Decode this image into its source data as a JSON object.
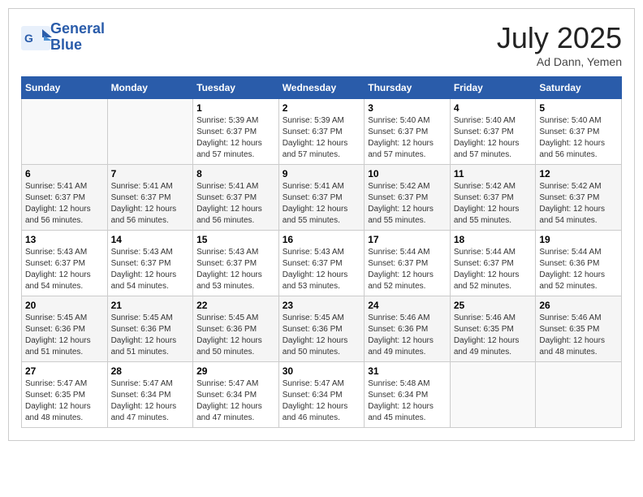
{
  "logo": {
    "line1": "General",
    "line2": "Blue"
  },
  "title": "July 2025",
  "subtitle": "Ad Dann, Yemen",
  "days_header": [
    "Sunday",
    "Monday",
    "Tuesday",
    "Wednesday",
    "Thursday",
    "Friday",
    "Saturday"
  ],
  "weeks": [
    [
      {
        "day": "",
        "info": ""
      },
      {
        "day": "",
        "info": ""
      },
      {
        "day": "1",
        "sunrise": "5:39 AM",
        "sunset": "6:37 PM",
        "daylight": "12 hours and 57 minutes."
      },
      {
        "day": "2",
        "sunrise": "5:39 AM",
        "sunset": "6:37 PM",
        "daylight": "12 hours and 57 minutes."
      },
      {
        "day": "3",
        "sunrise": "5:40 AM",
        "sunset": "6:37 PM",
        "daylight": "12 hours and 57 minutes."
      },
      {
        "day": "4",
        "sunrise": "5:40 AM",
        "sunset": "6:37 PM",
        "daylight": "12 hours and 57 minutes."
      },
      {
        "day": "5",
        "sunrise": "5:40 AM",
        "sunset": "6:37 PM",
        "daylight": "12 hours and 56 minutes."
      }
    ],
    [
      {
        "day": "6",
        "sunrise": "5:41 AM",
        "sunset": "6:37 PM",
        "daylight": "12 hours and 56 minutes."
      },
      {
        "day": "7",
        "sunrise": "5:41 AM",
        "sunset": "6:37 PM",
        "daylight": "12 hours and 56 minutes."
      },
      {
        "day": "8",
        "sunrise": "5:41 AM",
        "sunset": "6:37 PM",
        "daylight": "12 hours and 56 minutes."
      },
      {
        "day": "9",
        "sunrise": "5:41 AM",
        "sunset": "6:37 PM",
        "daylight": "12 hours and 55 minutes."
      },
      {
        "day": "10",
        "sunrise": "5:42 AM",
        "sunset": "6:37 PM",
        "daylight": "12 hours and 55 minutes."
      },
      {
        "day": "11",
        "sunrise": "5:42 AM",
        "sunset": "6:37 PM",
        "daylight": "12 hours and 55 minutes."
      },
      {
        "day": "12",
        "sunrise": "5:42 AM",
        "sunset": "6:37 PM",
        "daylight": "12 hours and 54 minutes."
      }
    ],
    [
      {
        "day": "13",
        "sunrise": "5:43 AM",
        "sunset": "6:37 PM",
        "daylight": "12 hours and 54 minutes."
      },
      {
        "day": "14",
        "sunrise": "5:43 AM",
        "sunset": "6:37 PM",
        "daylight": "12 hours and 54 minutes."
      },
      {
        "day": "15",
        "sunrise": "5:43 AM",
        "sunset": "6:37 PM",
        "daylight": "12 hours and 53 minutes."
      },
      {
        "day": "16",
        "sunrise": "5:43 AM",
        "sunset": "6:37 PM",
        "daylight": "12 hours and 53 minutes."
      },
      {
        "day": "17",
        "sunrise": "5:44 AM",
        "sunset": "6:37 PM",
        "daylight": "12 hours and 52 minutes."
      },
      {
        "day": "18",
        "sunrise": "5:44 AM",
        "sunset": "6:37 PM",
        "daylight": "12 hours and 52 minutes."
      },
      {
        "day": "19",
        "sunrise": "5:44 AM",
        "sunset": "6:36 PM",
        "daylight": "12 hours and 52 minutes."
      }
    ],
    [
      {
        "day": "20",
        "sunrise": "5:45 AM",
        "sunset": "6:36 PM",
        "daylight": "12 hours and 51 minutes."
      },
      {
        "day": "21",
        "sunrise": "5:45 AM",
        "sunset": "6:36 PM",
        "daylight": "12 hours and 51 minutes."
      },
      {
        "day": "22",
        "sunrise": "5:45 AM",
        "sunset": "6:36 PM",
        "daylight": "12 hours and 50 minutes."
      },
      {
        "day": "23",
        "sunrise": "5:45 AM",
        "sunset": "6:36 PM",
        "daylight": "12 hours and 50 minutes."
      },
      {
        "day": "24",
        "sunrise": "5:46 AM",
        "sunset": "6:36 PM",
        "daylight": "12 hours and 49 minutes."
      },
      {
        "day": "25",
        "sunrise": "5:46 AM",
        "sunset": "6:35 PM",
        "daylight": "12 hours and 49 minutes."
      },
      {
        "day": "26",
        "sunrise": "5:46 AM",
        "sunset": "6:35 PM",
        "daylight": "12 hours and 48 minutes."
      }
    ],
    [
      {
        "day": "27",
        "sunrise": "5:47 AM",
        "sunset": "6:35 PM",
        "daylight": "12 hours and 48 minutes."
      },
      {
        "day": "28",
        "sunrise": "5:47 AM",
        "sunset": "6:34 PM",
        "daylight": "12 hours and 47 minutes."
      },
      {
        "day": "29",
        "sunrise": "5:47 AM",
        "sunset": "6:34 PM",
        "daylight": "12 hours and 47 minutes."
      },
      {
        "day": "30",
        "sunrise": "5:47 AM",
        "sunset": "6:34 PM",
        "daylight": "12 hours and 46 minutes."
      },
      {
        "day": "31",
        "sunrise": "5:48 AM",
        "sunset": "6:34 PM",
        "daylight": "12 hours and 45 minutes."
      },
      {
        "day": "",
        "info": ""
      },
      {
        "day": "",
        "info": ""
      }
    ]
  ]
}
